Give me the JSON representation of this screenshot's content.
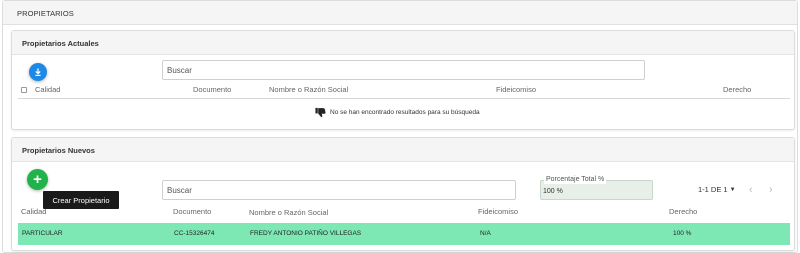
{
  "page": {
    "title": "PROPIETARIOS"
  },
  "current_owners": {
    "title": "Propietarios Actuales",
    "download_icon": "download-icon",
    "search": {
      "placeholder": "Buscar",
      "value": ""
    },
    "columns": [
      "Calidad",
      "Documento",
      "Nombre o Razón Social",
      "Fideicomiso",
      "Derecho"
    ],
    "empty_icon": "thumbs-down-icon",
    "empty_message": "No se han encontrado resultados para su búsqueda"
  },
  "new_owners": {
    "title": "Propietarios Nuevos",
    "add_icon": "plus-icon",
    "add_tooltip": "Crear Propietario",
    "search": {
      "placeholder": "Buscar",
      "value": ""
    },
    "percentage": {
      "label": "Porcentaje Total %",
      "value": "100 %"
    },
    "pagination": {
      "label": "1-1 DE 1",
      "caret_icon": "caret-down-icon",
      "prev_icon": "chevron-left-icon",
      "next_icon": "chevron-right-icon"
    },
    "columns": [
      "Calidad",
      "Documento",
      "Nombre o Razón Social",
      "Fideicomiso",
      "Derecho"
    ],
    "rows": [
      {
        "calidad": "PARTICULAR",
        "documento": "CC-15326474",
        "nombre": "FREDY ANTONIO PATIÑO VILLEGAS",
        "fideicomiso": "N/A",
        "derecho": "100 %"
      }
    ],
    "row_highlight_color": "#7ee8b5"
  },
  "colors": {
    "download_button": "#1e88e5",
    "add_button": "#21b24b"
  }
}
